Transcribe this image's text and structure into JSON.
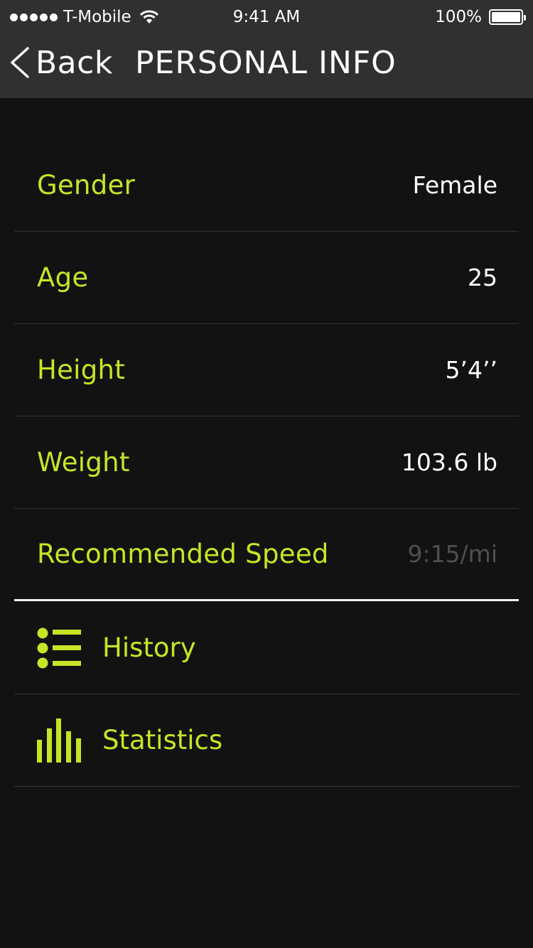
{
  "status_bar": {
    "carrier": "T-Mobile",
    "time": "9:41 AM",
    "battery": "100%"
  },
  "header": {
    "back_label": "Back",
    "title": "PERSONAL INFO"
  },
  "info": {
    "rows": [
      {
        "label": "Gender",
        "value": "Female"
      },
      {
        "label": "Age",
        "value": "25"
      },
      {
        "label": "Height",
        "value": "5’4’’"
      },
      {
        "label": "Weight",
        "value": "103.6 lb"
      },
      {
        "label": "Recommended Speed",
        "value": "9:15/mi"
      }
    ]
  },
  "nav": {
    "items": [
      {
        "label": "History",
        "icon": "list-icon"
      },
      {
        "label": "Statistics",
        "icon": "bar-chart-icon"
      }
    ]
  },
  "colors": {
    "accent": "#c9e426",
    "background": "#111312",
    "header": "#2f3030",
    "muted": "#4e504f"
  }
}
